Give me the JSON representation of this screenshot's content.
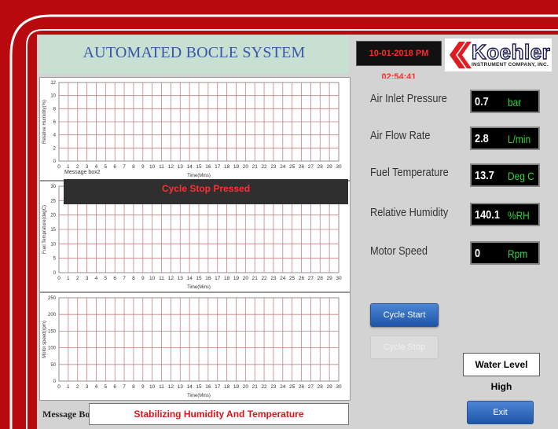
{
  "header": {
    "title": "AUTOMATED BOCLE SYSTEM",
    "datetime": "10-01-2018 PM 02:54:41",
    "logo_word": "Koehler",
    "logo_sub": "INSTRUMENT COMPANY, INC."
  },
  "charts": [
    {
      "ylabel": "Relative Humidity(%)",
      "xlabel": "Time(Mins)",
      "yticks": [
        "0",
        "2",
        "4",
        "6",
        "8",
        "10",
        "12"
      ],
      "xticks": [
        "0",
        "1",
        "2",
        "3",
        "4",
        "5",
        "6",
        "7",
        "8",
        "9",
        "10",
        "11",
        "12",
        "13",
        "14",
        "15",
        "16",
        "17",
        "18",
        "19",
        "20",
        "21",
        "22",
        "23",
        "24",
        "25",
        "26",
        "27",
        "28",
        "29",
        "30"
      ]
    },
    {
      "ylabel": "Fuel Temprature(degC)",
      "xlabel": "Time(Mins)",
      "yticks": [
        "0",
        "5",
        "10",
        "15",
        "20",
        "25",
        "30"
      ],
      "xticks": [
        "0",
        "1",
        "2",
        "3",
        "4",
        "5",
        "6",
        "7",
        "8",
        "9",
        "10",
        "11",
        "12",
        "13",
        "14",
        "15",
        "16",
        "17",
        "18",
        "19",
        "20",
        "21",
        "22",
        "23",
        "24",
        "25",
        "26",
        "27",
        "28",
        "29",
        "30"
      ]
    },
    {
      "ylabel": "Motor speed(rpm)",
      "xlabel": "Time(Mins)",
      "yticks": [
        "0",
        "50",
        "100",
        "150",
        "200",
        "250"
      ],
      "xticks": [
        "0",
        "1",
        "2",
        "3",
        "4",
        "5",
        "6",
        "7",
        "8",
        "9",
        "10",
        "11",
        "12",
        "13",
        "14",
        "15",
        "16",
        "17",
        "18",
        "19",
        "20",
        "21",
        "22",
        "23",
        "24",
        "25",
        "26",
        "27",
        "28",
        "29",
        "30"
      ]
    }
  ],
  "message_box2_label": "Message box2",
  "stop_banner": "Cycle Stop Pressed",
  "params": [
    {
      "label": "Air Inlet Pressure",
      "value": "0.7",
      "unit": "bar"
    },
    {
      "label": "Air Flow Rate",
      "value": "2.8",
      "unit": "L/min"
    },
    {
      "label": "Fuel Temperature",
      "value": "13.7",
      "unit": "Deg C"
    },
    {
      "label": "Relative Humidity",
      "value": "140.1",
      "unit": "%RH"
    },
    {
      "label": "Motor Speed",
      "value": "0",
      "unit": "Rpm"
    }
  ],
  "buttons": {
    "cycle_start": "Cycle Start",
    "cycle_stop": "Cycle Stop",
    "exit": "Exit"
  },
  "water_level": "Water Level High",
  "message_box": {
    "label": "Message Box",
    "text": "Stabilizing Humidity And Temperature"
  },
  "colors": {
    "frame_red": "#b8090f",
    "title_blue": "#3b57a9",
    "grid_red": "#c98080",
    "value_green": "#2bd63c",
    "button_blue": "#1d56a8"
  }
}
